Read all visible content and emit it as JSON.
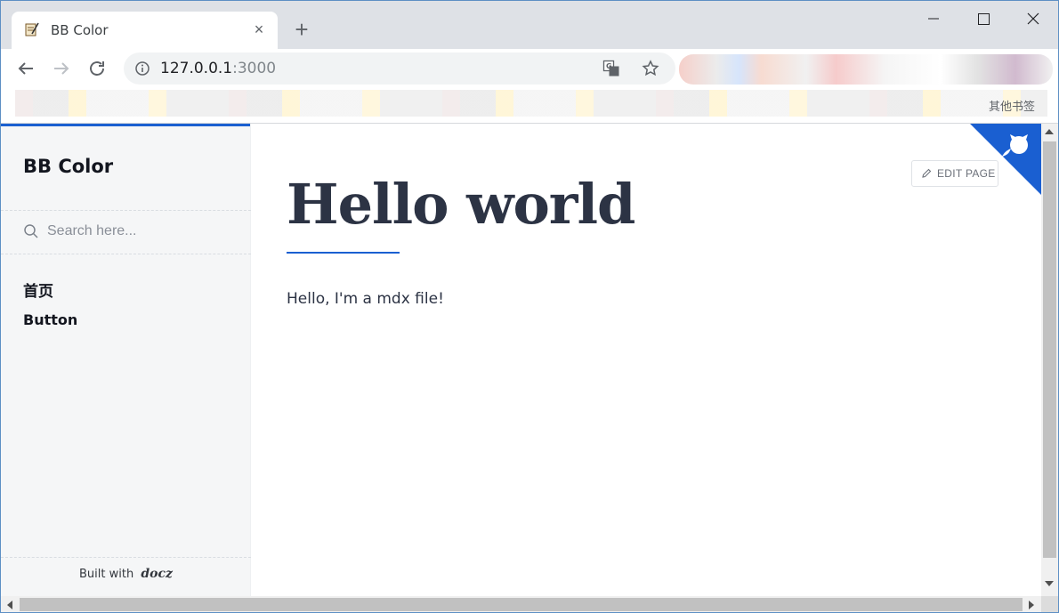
{
  "browser": {
    "tab_title": "BB Color",
    "tab_close": "×",
    "new_tab": "+",
    "url_host": "127.0.0.1",
    "url_port": ":3000",
    "bookmark_partial": "其他书签"
  },
  "sidebar": {
    "brand": "BB Color",
    "search_placeholder": "Search here...",
    "menu": [
      {
        "label": "首页"
      },
      {
        "label": "Button"
      }
    ],
    "built_with": "Built with",
    "docz_logo": "docz"
  },
  "main": {
    "title": "Hello world",
    "paragraph": "Hello, I'm a mdx file!",
    "edit_label": "EDIT PAGE"
  },
  "colors": {
    "accent": "#1a5fd1",
    "heading": "#2c3344",
    "sidebar_bg": "#f5f6f7",
    "github_corner": "#1a5fd1"
  },
  "icons": {
    "tab_favicon": "document-pen-icon",
    "back": "arrow-left-icon",
    "forward": "arrow-right-icon",
    "reload": "reload-icon",
    "info": "info-icon",
    "translate": "translate-icon",
    "bookmark_star": "star-icon",
    "search": "search-icon",
    "edit": "pencil-icon",
    "github": "github-octocat-icon"
  }
}
